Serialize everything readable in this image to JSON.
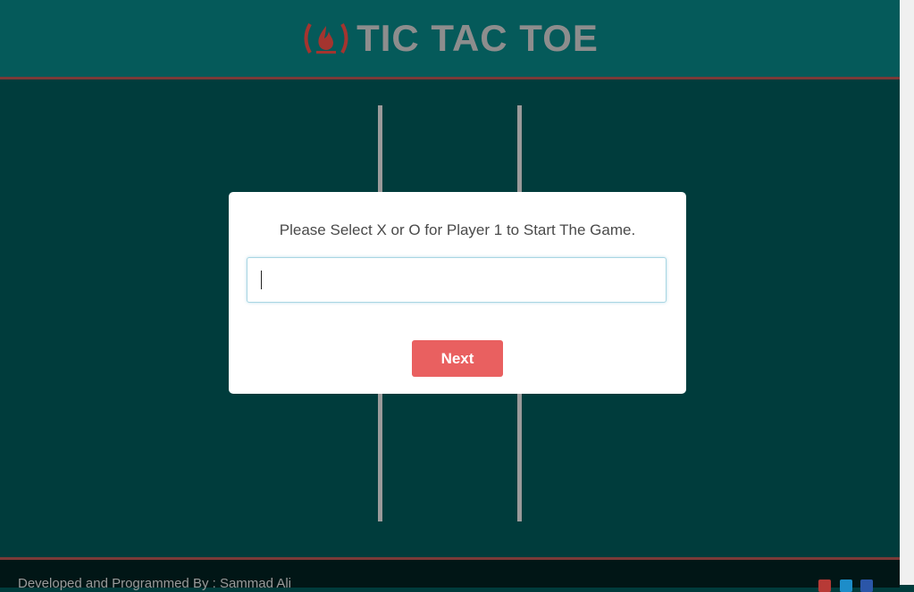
{
  "header": {
    "title": "TIC TAC TOE",
    "logo_icon": "fire-icon",
    "logo_color": "#a4342f"
  },
  "modal": {
    "message": "Please Select X or O for Player 1 to Start The Game.",
    "input_value": "",
    "button_label": "Next",
    "button_color": "#e96060"
  },
  "footer": {
    "credit": "Developed and Programmed By : Sammad Ali",
    "social_icons": [
      "google-plus-icon",
      "twitter-icon",
      "facebook-icon"
    ]
  },
  "colors": {
    "background": "#003c3c",
    "header": "#055a5a",
    "accent_border": "#7a3a38",
    "grid": "#9a9a9a"
  }
}
